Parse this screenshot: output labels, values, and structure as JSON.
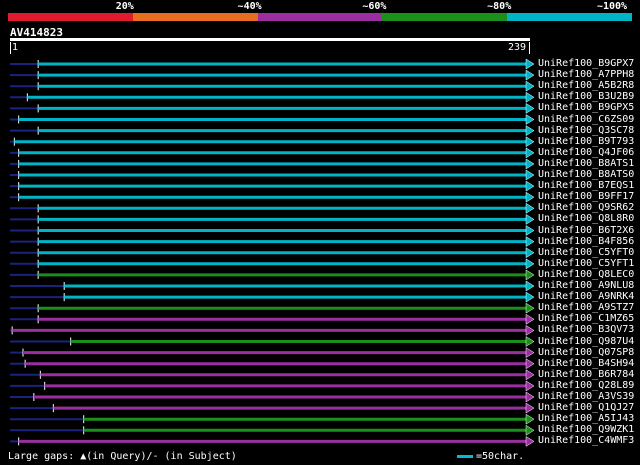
{
  "legend": {
    "segments": [
      {
        "label": "",
        "color": "#e01b2b"
      },
      {
        "label": "20%",
        "color": "#e86d1f"
      },
      {
        "label": "~40%",
        "color": "#9b2ea0"
      },
      {
        "label": "~60%",
        "color": "#1a8f1a"
      },
      {
        "label": "~80%",
        "color": "#00b4c8"
      },
      {
        "label": "~100%",
        "color": ""
      }
    ],
    "labels": [
      "20%",
      "~40%",
      "~60%",
      "~80%",
      "~100%"
    ]
  },
  "query": {
    "name": "AV414823",
    "start": "1",
    "end": "239",
    "length": 239
  },
  "colors": {
    "cyan": "#00b4c8",
    "green": "#1a8f1a",
    "purple": "#9b2ea0",
    "navy": "#1a237e"
  },
  "hits": [
    {
      "name": "UniRef100_B9GPX7",
      "start": 14,
      "color": "cyan"
    },
    {
      "name": "UniRef100_A7PPH8",
      "start": 14,
      "color": "cyan"
    },
    {
      "name": "UniRef100_A5B2R8",
      "start": 14,
      "color": "cyan"
    },
    {
      "name": "UniRef100_B3U2B9",
      "start": 9,
      "color": "cyan"
    },
    {
      "name": "UniRef100_B9GPX5",
      "start": 14,
      "color": "cyan"
    },
    {
      "name": "UniRef100_C6ZS09",
      "start": 5,
      "color": "cyan"
    },
    {
      "name": "UniRef100_Q3SC78",
      "start": 14,
      "color": "cyan"
    },
    {
      "name": "UniRef100_B9T793",
      "start": 3,
      "color": "cyan"
    },
    {
      "name": "UniRef100_Q4JF06",
      "start": 5,
      "color": "cyan"
    },
    {
      "name": "UniRef100_B8ATS1",
      "start": 5,
      "color": "cyan"
    },
    {
      "name": "UniRef100_B8ATS0",
      "start": 5,
      "color": "cyan"
    },
    {
      "name": "UniRef100_B7EQS1",
      "start": 5,
      "color": "cyan"
    },
    {
      "name": "UniRef100_B9FF17",
      "start": 5,
      "color": "cyan"
    },
    {
      "name": "UniRef100_Q9SR62",
      "start": 14,
      "color": "cyan"
    },
    {
      "name": "UniRef100_Q8L8R0",
      "start": 14,
      "color": "cyan"
    },
    {
      "name": "UniRef100_B6T2X6",
      "start": 14,
      "color": "cyan"
    },
    {
      "name": "UniRef100_B4F856",
      "start": 14,
      "color": "cyan"
    },
    {
      "name": "UniRef100_C5YFT0",
      "start": 14,
      "color": "cyan"
    },
    {
      "name": "UniRef100_C5YFT1",
      "start": 14,
      "color": "cyan"
    },
    {
      "name": "UniRef100_Q8LEC0",
      "start": 14,
      "color": "green"
    },
    {
      "name": "UniRef100_A9NLU8",
      "start": 26,
      "color": "cyan"
    },
    {
      "name": "UniRef100_A9NRK4",
      "start": 26,
      "color": "cyan"
    },
    {
      "name": "UniRef100_A9STZ7",
      "start": 14,
      "color": "green"
    },
    {
      "name": "UniRef100_C1MZ65",
      "start": 14,
      "color": "purple"
    },
    {
      "name": "UniRef100_B3QV73",
      "start": 2,
      "color": "purple"
    },
    {
      "name": "UniRef100_Q987U4",
      "start": 29,
      "color": "green"
    },
    {
      "name": "UniRef100_Q07SP8",
      "start": 7,
      "color": "purple"
    },
    {
      "name": "UniRef100_B4SH94",
      "start": 8,
      "color": "purple"
    },
    {
      "name": "UniRef100_B6R784",
      "start": 15,
      "color": "purple"
    },
    {
      "name": "UniRef100_Q28L89",
      "start": 17,
      "color": "purple"
    },
    {
      "name": "UniRef100_A3VS39",
      "start": 12,
      "color": "purple"
    },
    {
      "name": "UniRef100_Q1QJ27",
      "start": 21,
      "color": "purple"
    },
    {
      "name": "UniRef100_A5IJ43",
      "start": 35,
      "color": "green"
    },
    {
      "name": "UniRef100_Q9WZK1",
      "start": 35,
      "color": "green"
    },
    {
      "name": "UniRef100_C4WMF3",
      "start": 5,
      "color": "purple"
    }
  ],
  "footer": {
    "text": "Large gaps: ▲(in Query)/- (in Subject)",
    "scale": "=50char."
  }
}
